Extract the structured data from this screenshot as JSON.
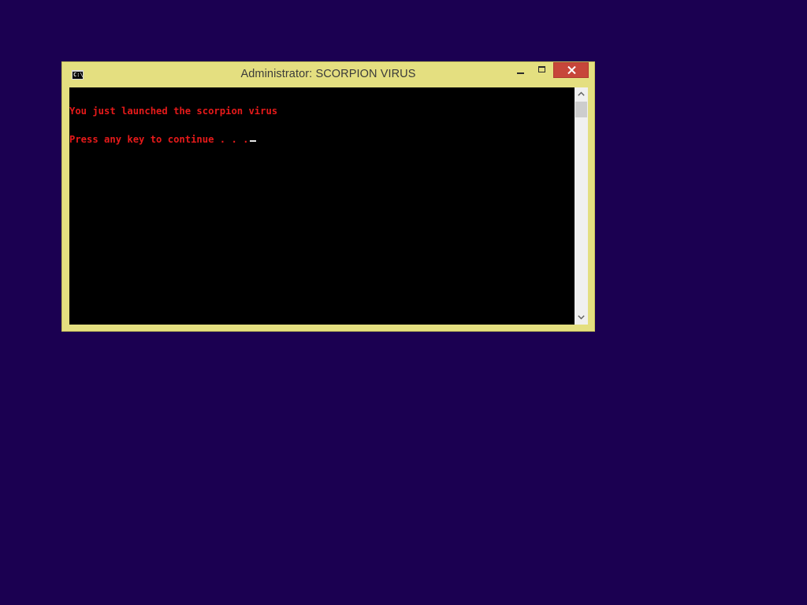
{
  "desktop": {
    "background_color": "#1b0051"
  },
  "window": {
    "title": "Administrator:  SCORPION VIRUS",
    "frame_color": "#e4df80",
    "app_icon": "command-prompt-icon",
    "app_icon_text": "C:\\",
    "controls": {
      "minimize": "minimize-icon",
      "maximize": "maximize-icon",
      "close": "close-icon",
      "close_color": "#c7463a"
    }
  },
  "console": {
    "text_color": "#e61a1a",
    "background_color": "#000000",
    "lines": [
      "You just launched the scorpion virus",
      "Press any key to continue . . ."
    ],
    "cursor_color": "#e8e8e8"
  },
  "scrollbar": {
    "up_icon": "chevron-up-icon",
    "down_icon": "chevron-down-icon"
  }
}
